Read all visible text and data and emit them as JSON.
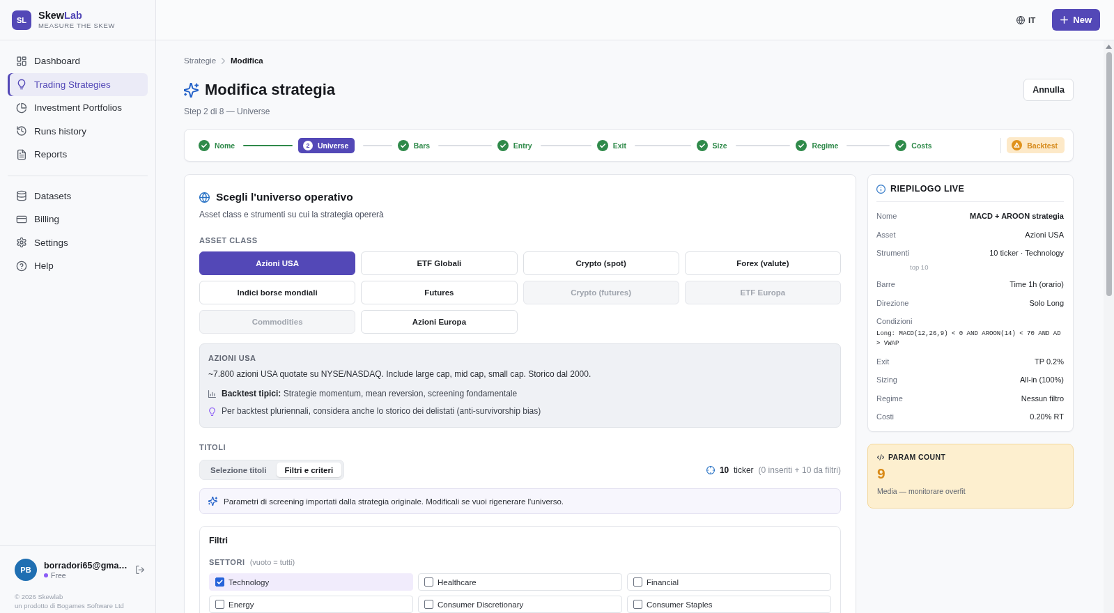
{
  "brand": {
    "logo": "SL",
    "name": "Skew",
    "name_accent": "Lab",
    "tagline": "MEASURE THE SKEW"
  },
  "sidebar": {
    "sections": [
      {
        "items": [
          {
            "label": "Dashboard",
            "selected": false
          },
          {
            "label": "Trading Strategies",
            "selected": true
          },
          {
            "label": "Investment Portfolios",
            "selected": false
          },
          {
            "label": "Runs history",
            "selected": false
          },
          {
            "label": "Reports",
            "selected": false
          }
        ]
      },
      {
        "items": [
          {
            "label": "Datasets",
            "selected": false
          },
          {
            "label": "Billing",
            "selected": false
          },
          {
            "label": "Settings",
            "selected": false
          },
          {
            "label": "Help",
            "selected": false
          }
        ]
      }
    ]
  },
  "user": {
    "initials": "PB",
    "email": "borradori65@gma…",
    "plan": "Free"
  },
  "footer": {
    "copyright": "© 2026 Skewlab",
    "credit": "un prodotto di Bogames Software Ltd"
  },
  "topbar": {
    "language": "IT",
    "new_button": "New"
  },
  "breadcrumb": [
    "Strategie",
    "Modifica"
  ],
  "page": {
    "title": "Modifica strategia",
    "subtitle": "Step 2 di 8 — Universe",
    "cancel_button": "Annulla"
  },
  "stepper": {
    "steps": [
      {
        "label": "Nome",
        "done": true,
        "selected": false
      },
      {
        "label": "Universe",
        "done": false,
        "selected": true,
        "number": "2"
      },
      {
        "label": "Bars",
        "done": true,
        "selected": false
      },
      {
        "label": "Entry",
        "done": true,
        "selected": false
      },
      {
        "label": "Exit",
        "done": true,
        "selected": false
      },
      {
        "label": "Size",
        "done": true,
        "selected": false
      },
      {
        "label": "Regime",
        "done": true,
        "selected": false
      },
      {
        "label": "Costs",
        "done": true,
        "selected": false
      }
    ],
    "final_step": {
      "label": "Backtest",
      "warning": true
    }
  },
  "universe": {
    "title": "Scegli l'universo operativo",
    "subtitle": "Asset class e strumenti su cui la strategia opererà",
    "asset_class_label": "ASSET CLASS",
    "asset_classes": [
      {
        "label": "Azioni USA",
        "selected": true,
        "disabled": false
      },
      {
        "label": "ETF Globali",
        "selected": false,
        "disabled": false
      },
      {
        "label": "Crypto (spot)",
        "selected": false,
        "disabled": false
      },
      {
        "label": "Forex (valute)",
        "selected": false,
        "disabled": false
      },
      {
        "label": "Indici borse mondiali",
        "selected": false,
        "disabled": false
      },
      {
        "label": "Futures",
        "selected": false,
        "disabled": false
      },
      {
        "label": "Crypto (futures)",
        "selected": false,
        "disabled": true
      },
      {
        "label": "ETF Europa",
        "selected": false,
        "disabled": true
      },
      {
        "label": "Commodities",
        "selected": false,
        "disabled": true
      },
      {
        "label": "Azioni Europa",
        "selected": false,
        "disabled": false
      }
    ],
    "info": {
      "heading": "AZIONI USA",
      "description": "~7.800 azioni USA quotate su NYSE/NASDAQ. Include large cap, mid cap, small cap. Storico dal 2000.",
      "typical": "**Backtest tipici:** Strategie momentum, mean reversion, screening fondamentale",
      "hint": "Per backtest pluriennali, considera anche lo storico dei delistati (anti-survivorship bias)"
    },
    "titles": {
      "label": "TITOLI",
      "tabs": [
        {
          "label": "Selezione titoli",
          "selected": false
        },
        {
          "label": "Filtri e criteri",
          "selected": true
        }
      ],
      "count": "10",
      "count_unit": "ticker",
      "count_detail": "(0 inseriti + 10 da filtri)"
    },
    "notice": "Parametri di screening importati dalla strategia originale. Modificali se vuoi rigenerare l'universo.",
    "filters": {
      "title": "Filtri",
      "sectors_label": "SETTORI",
      "sectors_hint": "(vuoto = tutti)",
      "sectors": [
        {
          "label": "Technology",
          "checked": true
        },
        {
          "label": "Healthcare",
          "checked": false
        },
        {
          "label": "Financial",
          "checked": false
        },
        {
          "label": "Energy",
          "checked": false
        },
        {
          "label": "Consumer Discretionary",
          "checked": false
        },
        {
          "label": "Consumer Staples",
          "checked": false
        }
      ]
    }
  },
  "summary": {
    "title": "RIEPILOGO LIVE",
    "rows": [
      {
        "kind": "strong",
        "label": "Nome",
        "value": "MACD + AROON strategia"
      },
      {
        "kind": "plain",
        "label": "Asset",
        "value": "Azioni USA"
      },
      {
        "kind": "plain",
        "label": "Strumenti",
        "value": "10 ticker · Technology",
        "note": "top 10"
      },
      {
        "kind": "plain",
        "label": "Barre",
        "value": "Time 1h (orario)"
      },
      {
        "kind": "plain",
        "label": "Direzione",
        "value": "Solo Long"
      },
      {
        "kind": "code",
        "label": "Condizioni",
        "value": "Long: MACD(12,26,9) < 0 AND AROON(14) < 70 AND AD > VWAP"
      },
      {
        "kind": "plain",
        "label": "Exit",
        "value": "TP 0.2%"
      },
      {
        "kind": "plain",
        "label": "Sizing",
        "value": "All-in (100%)"
      },
      {
        "kind": "plain",
        "label": "Regime",
        "value": "Nessun filtro"
      },
      {
        "kind": "plain",
        "label": "Costi",
        "value": "0.20% RT"
      }
    ]
  },
  "param_count": {
    "title": "PARAM COUNT",
    "value": "9",
    "note": "Media — monitorare overfit"
  }
}
